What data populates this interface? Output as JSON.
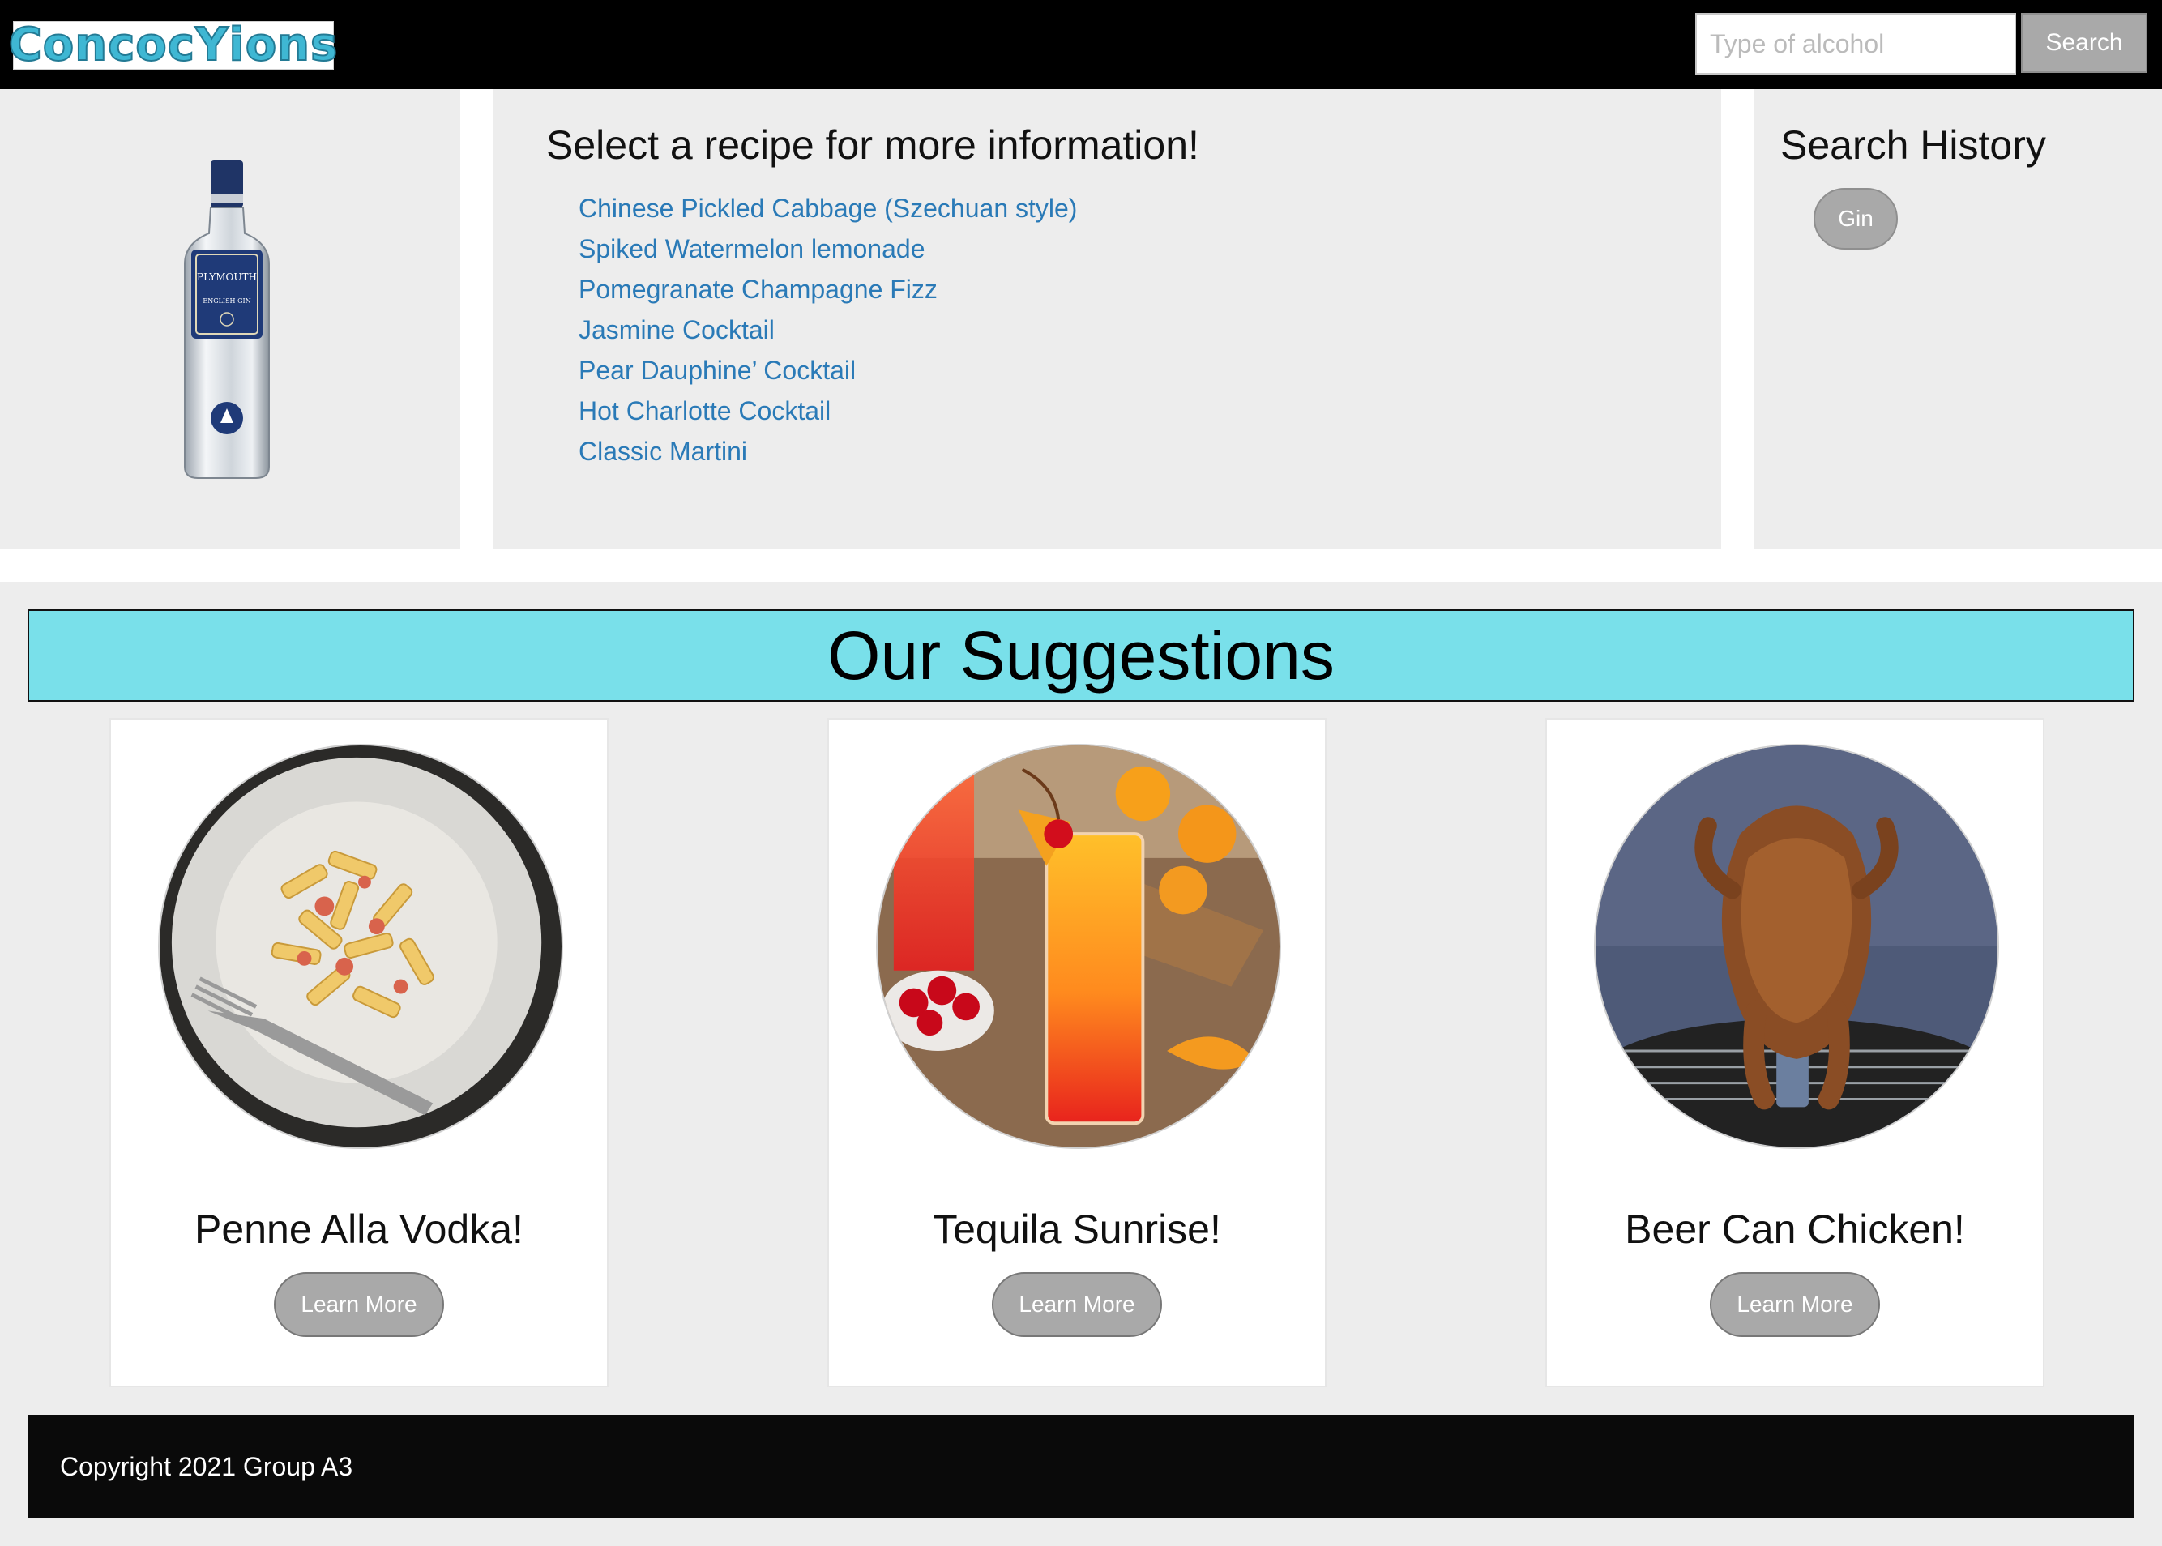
{
  "header": {
    "logo_text": "ConcocYions",
    "search": {
      "placeholder": "Type of alcohol",
      "value": ""
    },
    "search_label": "Search"
  },
  "recipes": {
    "heading": "Select a recipe for more information!",
    "items": [
      "Chinese Pickled Cabbage (Szechuan style)",
      "Spiked Watermelon lemonade",
      "Pomegranate Champagne Fizz",
      "Jasmine Cocktail",
      "Pear Dauphine’ Cocktail",
      "Hot Charlotte Cocktail",
      "Classic Martini"
    ]
  },
  "bottle": {
    "label_lines": [
      "PLYMOUTH",
      "ENGLISH GIN"
    ]
  },
  "history": {
    "heading": "Search History",
    "items": [
      "Gin"
    ]
  },
  "suggestions": {
    "heading": "Our Suggestions",
    "cards": [
      {
        "title": "Penne Alla Vodka!",
        "button": "Learn More",
        "image": "penne-pasta-photo"
      },
      {
        "title": "Tequila Sunrise!",
        "button": "Learn More",
        "image": "tequila-sunrise-photo"
      },
      {
        "title": "Beer Can Chicken!",
        "button": "Learn More",
        "image": "beer-can-chicken-photo"
      }
    ]
  },
  "footer": {
    "text": "Copyright 2021 Group A3"
  },
  "colors": {
    "header_bg": "#000000",
    "panel_bg": "#ededed",
    "banner_bg": "#79e0ea",
    "link": "#2a7ab7",
    "button_gray": "#a9a9a9",
    "logo_cyan": "#3fb7d3"
  }
}
